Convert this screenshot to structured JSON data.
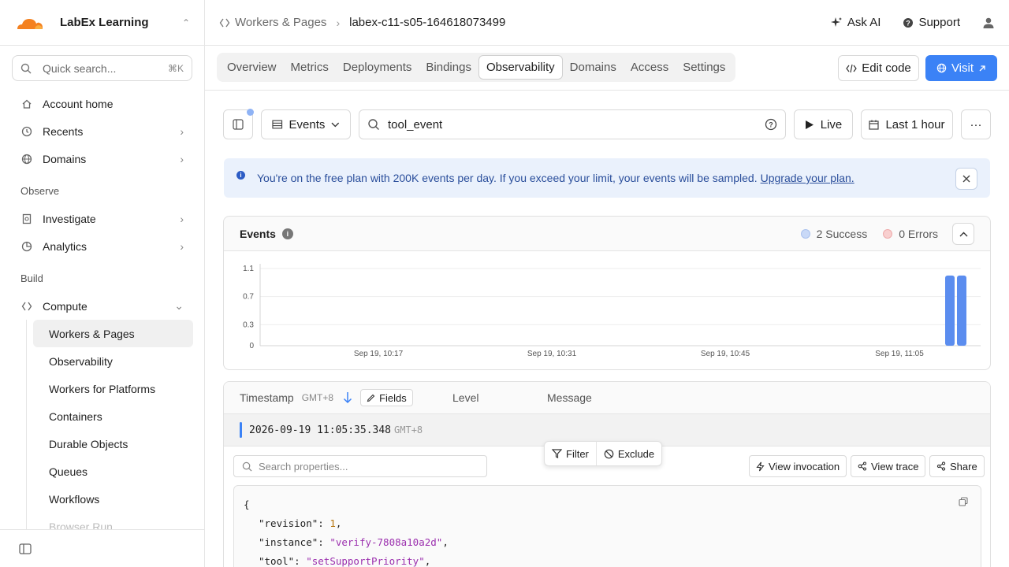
{
  "brand": {
    "name": "LabEx Learning"
  },
  "search": {
    "placeholder": "Quick search...",
    "shortcut": "⌘K"
  },
  "nav": {
    "top": [
      {
        "label": "Account home",
        "icon": "home-icon"
      },
      {
        "label": "Recents",
        "icon": "clock-icon"
      },
      {
        "label": "Domains",
        "icon": "globe-icon"
      }
    ],
    "observe_header": "Observe",
    "observe": [
      {
        "label": "Investigate",
        "icon": "investigate-icon"
      },
      {
        "label": "Analytics",
        "icon": "analytics-icon"
      }
    ],
    "build_header": "Build",
    "compute": "Compute",
    "compute_items": [
      "Workers & Pages",
      "Observability",
      "Workers for Platforms",
      "Containers",
      "Durable Objects",
      "Queues",
      "Workflows",
      "Browser Run"
    ]
  },
  "breadcrumb": {
    "parent": "Workers & Pages",
    "current": "labex-c11-s05-164618073499"
  },
  "topbar": {
    "ask_ai": "Ask AI",
    "support": "Support"
  },
  "tabs": [
    "Overview",
    "Metrics",
    "Deployments",
    "Bindings",
    "Observability",
    "Domains",
    "Access",
    "Settings"
  ],
  "active_tab": "Observability",
  "actions": {
    "edit_code": "Edit code",
    "visit": "Visit"
  },
  "toolbar": {
    "view": "Events",
    "query": "tool_event",
    "live": "Live",
    "time_range": "Last 1 hour",
    "more": "···"
  },
  "banner": {
    "text": "You're on the free plan with 200K events per day. If you exceed your limit, your events will be sampled.",
    "link": "Upgrade your plan."
  },
  "events_card": {
    "title": "Events",
    "success_label": "2 Success",
    "errors_label": "0 Errors"
  },
  "chart_data": {
    "type": "bar",
    "y_ticks": [
      "1.1",
      "0.7",
      "0.3",
      "0"
    ],
    "ylim": [
      0,
      1.1
    ],
    "x_ticks": [
      "Sep 19, 10:17",
      "Sep 19, 10:31",
      "Sep 19, 10:45",
      "Sep 19, 11:05"
    ],
    "series": [
      {
        "name": "Success",
        "values": [
          1,
          1
        ]
      }
    ],
    "bar_times": [
      "Sep 19, 11:05",
      "Sep 19, 11:06"
    ],
    "color": "#5b8def"
  },
  "table": {
    "timestamp_header": "Timestamp",
    "tz": "GMT+8",
    "fields_label": "Fields",
    "level_header": "Level",
    "message_header": "Message",
    "row_timestamp": "2026-09-19 11:05:35.348",
    "row_tz": "GMT+8",
    "props_placeholder": "Search properties...",
    "filter": "Filter",
    "exclude": "Exclude",
    "view_invocation": "View invocation",
    "view_trace": "View trace",
    "share": "Share"
  },
  "json": {
    "open": "{",
    "lines": [
      {
        "key": "\"revision\"",
        "value": "1",
        "kind": "n"
      },
      {
        "key": "\"instance\"",
        "value": "\"verify-7808a10a2d\"",
        "kind": "s"
      },
      {
        "key": "\"tool\"",
        "value": "\"setSupportPriority\"",
        "kind": "s"
      }
    ]
  }
}
